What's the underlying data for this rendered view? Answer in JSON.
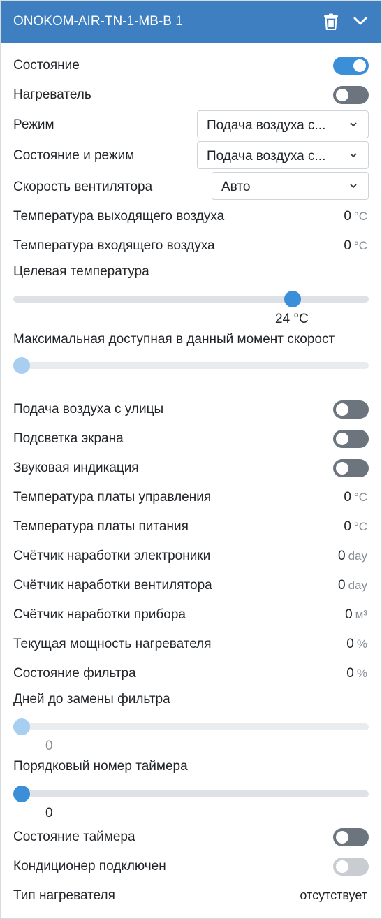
{
  "header": {
    "title": "ONOKOM-AIR-TN-1-MB-B 1",
    "icons": [
      "trash-icon",
      "chevron-down-icon"
    ],
    "color": "#3d7fc1"
  },
  "rows": {
    "state": {
      "label": "Состояние",
      "on": true
    },
    "heater": {
      "label": "Нагреватель",
      "on": false
    },
    "mode": {
      "label": "Режим",
      "value": "Подача воздуха с..."
    },
    "state_mode": {
      "label": "Состояние и режим",
      "value": "Подача воздуха с..."
    },
    "fan_speed": {
      "label": "Скорость вентилятора",
      "value": "Авто"
    },
    "outlet_temp": {
      "label": "Температура выходящего воздуха",
      "value": "0",
      "unit": "°C"
    },
    "inlet_temp": {
      "label": "Температура входящего воздуха",
      "value": "0",
      "unit": "°C"
    },
    "target_temp": {
      "label": "Целевая температура",
      "value_text": "24 °C",
      "level": 0.79
    },
    "max_speed": {
      "label": "Максимальная доступная в данный момент скорост",
      "level": 0.0
    },
    "street_air": {
      "label": "Подача воздуха с улицы",
      "on": false
    },
    "backlight": {
      "label": "Подсветка экрана",
      "on": false
    },
    "sound": {
      "label": "Звуковая индикация",
      "on": false
    },
    "ctrl_board_temp": {
      "label": "Температура платы управления",
      "value": "0",
      "unit": "°C"
    },
    "power_board_temp": {
      "label": "Температура платы питания",
      "value": "0",
      "unit": "°C"
    },
    "electronics_counter": {
      "label": "Счётчик наработки электроники",
      "value": "0",
      "unit": "day"
    },
    "fan_counter": {
      "label": "Счётчик наработки вентилятора",
      "value": "0",
      "unit": "day"
    },
    "device_counter": {
      "label": "Счётчик наработки прибора",
      "value": "0",
      "unit": "м³"
    },
    "heater_power": {
      "label": "Текущая мощность нагревателя",
      "value": "0",
      "unit": "%"
    },
    "filter_state": {
      "label": "Состояние фильтра",
      "value": "0",
      "unit": "%"
    },
    "filter_days": {
      "label": "Дней до замены фильтра",
      "value_text": "0",
      "level": 0.0
    },
    "timer_number": {
      "label": "Порядковый номер таймера",
      "value_text": "0",
      "level": 0.0
    },
    "timer_state": {
      "label": "Состояние таймера",
      "on": false
    },
    "ac_connected": {
      "label": "Кондиционер подключен",
      "on": false,
      "disabled": true
    },
    "heater_type": {
      "label": "Тип нагревателя",
      "value": "отсутствует"
    }
  },
  "colors": {
    "accent": "#3a8fd8",
    "toggle_off": "#6c757d",
    "toggle_disabled": "#c9cdd1"
  }
}
